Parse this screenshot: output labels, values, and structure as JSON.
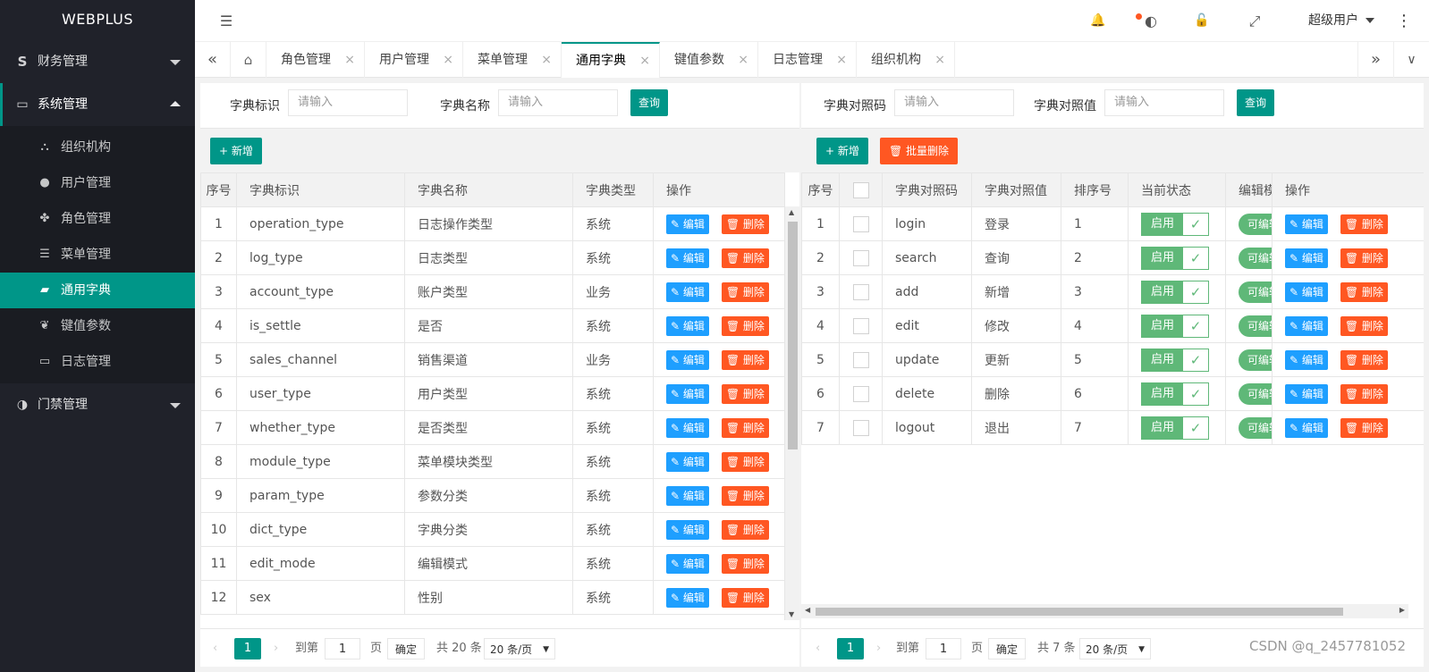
{
  "app": {
    "logo": "WEBPLUS"
  },
  "sidebar": {
    "groups": [
      {
        "label": "财务管理",
        "icon": "finance-icon",
        "glyph": "S"
      },
      {
        "label": "系统管理",
        "icon": "monitor-icon",
        "glyph": "▭"
      },
      {
        "label": "门禁管理",
        "icon": "half-circle-icon",
        "glyph": "◑"
      }
    ],
    "items": [
      {
        "label": "组织机构",
        "icon": "org-tree-icon",
        "glyph": "⛬"
      },
      {
        "label": "用户管理",
        "icon": "user-icon",
        "glyph": "●"
      },
      {
        "label": "角色管理",
        "icon": "paw-icon",
        "glyph": "✤"
      },
      {
        "label": "菜单管理",
        "icon": "list-icon",
        "glyph": "☰"
      },
      {
        "label": "通用字典",
        "icon": "book-icon",
        "glyph": "▰"
      },
      {
        "label": "键值参数",
        "icon": "leaf-icon",
        "glyph": "❦"
      },
      {
        "label": "日志管理",
        "icon": "monitor-icon",
        "glyph": "▭"
      }
    ]
  },
  "header": {
    "user": "超级用户",
    "icons": {
      "collapse": "☰",
      "bell": "🔔",
      "palette": "◐",
      "lock": "🔓",
      "fullscreen": "⤢",
      "more": "⋮"
    }
  },
  "tabs": {
    "items": [
      "角色管理",
      "用户管理",
      "菜单管理",
      "通用字典",
      "键值参数",
      "日志管理",
      "组织机构"
    ],
    "active": "通用字典",
    "close": "×",
    "left": "«",
    "home": "⌂",
    "right": "»",
    "down": "∨"
  },
  "left": {
    "search": {
      "label1": "字典标识",
      "placeholder1": "请输入",
      "label2": "字典名称",
      "placeholder2": "请输入",
      "button": "查询"
    },
    "add": "+ 新增",
    "columns": [
      "序号",
      "字典标识",
      "字典名称",
      "字典类型",
      "操作"
    ],
    "rows": [
      [
        "1",
        "operation_type",
        "日志操作类型",
        "系统"
      ],
      [
        "2",
        "log_type",
        "日志类型",
        "系统"
      ],
      [
        "3",
        "account_type",
        "账户类型",
        "业务"
      ],
      [
        "4",
        "is_settle",
        "是否",
        "系统"
      ],
      [
        "5",
        "sales_channel",
        "销售渠道",
        "业务"
      ],
      [
        "6",
        "user_type",
        "用户类型",
        "系统"
      ],
      [
        "7",
        "whether_type",
        "是否类型",
        "系统"
      ],
      [
        "8",
        "module_type",
        "菜单模块类型",
        "系统"
      ],
      [
        "9",
        "param_type",
        "参数分类",
        "系统"
      ],
      [
        "10",
        "dict_type",
        "字典分类",
        "系统"
      ],
      [
        "11",
        "edit_mode",
        "编辑模式",
        "系统"
      ],
      [
        "12",
        "sex",
        "性别",
        "系统"
      ]
    ],
    "edit": "✎ 编辑",
    "del": "🗑 删除",
    "pager": {
      "page": "1",
      "goto": "到第",
      "input": "1",
      "unit": "页",
      "confirm": "确定",
      "total": "共 20 条",
      "size": "20 条/页"
    }
  },
  "right": {
    "search": {
      "label1": "字典对照码",
      "placeholder1": "请输入",
      "label2": "字典对照值",
      "placeholder2": "请输入",
      "button": "查询"
    },
    "add": "+ 新增",
    "batch_delete": "🗑 批量删除",
    "columns": [
      "序号",
      "",
      "字典对照码",
      "字典对照值",
      "排序号",
      "当前状态",
      "编辑模",
      "操作"
    ],
    "rows": [
      [
        "1",
        "login",
        "登录",
        "1"
      ],
      [
        "2",
        "search",
        "查询",
        "2"
      ],
      [
        "3",
        "add",
        "新增",
        "3"
      ],
      [
        "4",
        "edit",
        "修改",
        "4"
      ],
      [
        "5",
        "update",
        "更新",
        "5"
      ],
      [
        "6",
        "delete",
        "删除",
        "6"
      ],
      [
        "7",
        "logout",
        "退出",
        "7"
      ]
    ],
    "status_on": "启用",
    "check": "✓",
    "edit_mode": "可编辑",
    "edit": "✎ 编辑",
    "del": "🗑 删除",
    "pager": {
      "page": "1",
      "goto": "到第",
      "input": "1",
      "unit": "页",
      "confirm": "确定",
      "total": "共 7 条",
      "size": "20 条/页"
    }
  },
  "watermark": "CSDN @q_2457781052",
  "colors": {
    "primary": "#009688",
    "danger": "#ff5722",
    "info": "#1e9fff",
    "success": "#5fb878",
    "sidebar": "#20222a"
  }
}
